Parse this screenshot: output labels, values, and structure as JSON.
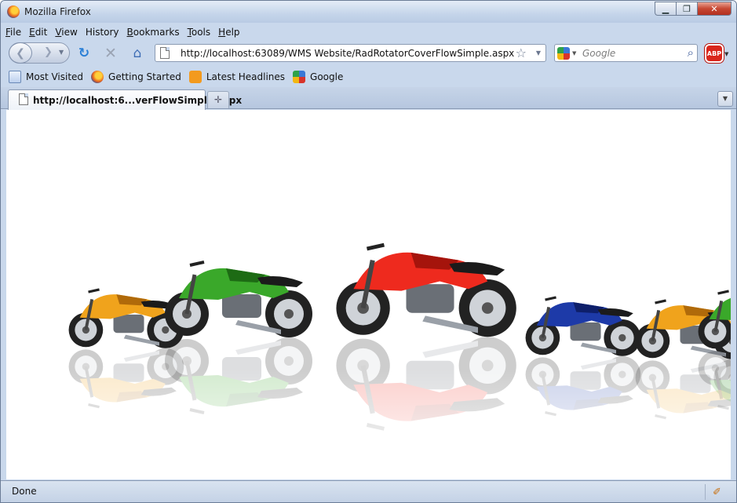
{
  "window": {
    "title": "Mozilla Firefox"
  },
  "menu": [
    {
      "key": "F",
      "rest": "ile"
    },
    {
      "key": "E",
      "rest": "dit"
    },
    {
      "key": "V",
      "rest": "iew"
    },
    {
      "key": "H",
      "rest": "istory",
      "prefix": "Hi",
      "suffix": "story"
    },
    {
      "key": "B",
      "rest": "ookmarks"
    },
    {
      "key": "T",
      "rest": "ools"
    },
    {
      "key": "H",
      "rest": "elp"
    }
  ],
  "address": {
    "url": "http://localhost:63089/WMS Website/RadRotatorCoverFlowSimple.aspx"
  },
  "search": {
    "placeholder": "Google"
  },
  "addon": {
    "abp_label": "ABP"
  },
  "bookmarks": [
    {
      "label": "Most Visited",
      "icon": "most-visited-icon"
    },
    {
      "label": "Getting Started",
      "icon": "firefox-icon"
    },
    {
      "label": "Latest Headlines",
      "icon": "rss-icon"
    },
    {
      "label": "Google",
      "icon": "google-icon"
    }
  ],
  "tab": {
    "title": "http://localhost:6...verFlowSimple.aspx"
  },
  "status": {
    "text": "Done"
  },
  "bikes": [
    {
      "name": "yellow-naked-bike",
      "body": "#f0a31c",
      "accent": "#b06a0a"
    },
    {
      "name": "green-bike",
      "body": "#3aa82a",
      "accent": "#1d6b14"
    },
    {
      "name": "red-sport-bike",
      "body": "#ee2a1e",
      "accent": "#a5140c"
    },
    {
      "name": "blue-sport-bike",
      "body": "#1d3aa8",
      "accent": "#0e1f6a"
    },
    {
      "name": "yellow-naked-bike-right",
      "body": "#f0a31c",
      "accent": "#b06a0a"
    },
    {
      "name": "green-bike-partial",
      "body": "#3aa82a",
      "accent": "#1d6b14"
    }
  ]
}
